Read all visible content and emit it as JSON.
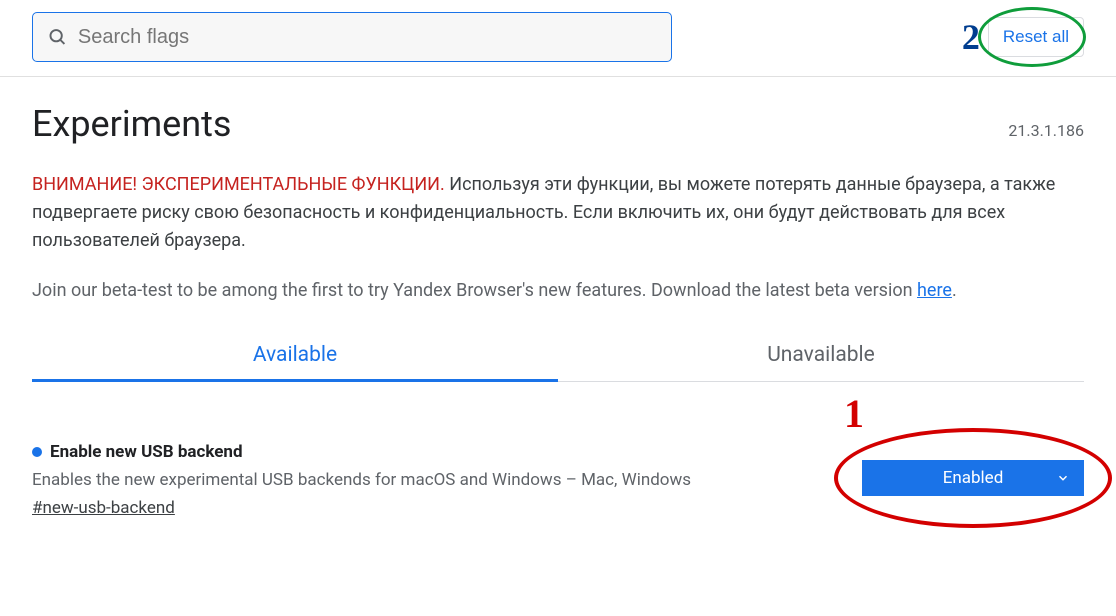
{
  "search": {
    "placeholder": "Search flags"
  },
  "annotations": {
    "one": "1",
    "two": "2"
  },
  "reset": {
    "label": "Reset all"
  },
  "header": {
    "title": "Experiments",
    "version": "21.3.1.186"
  },
  "warning": {
    "label": "ВНИМАНИЕ! ЭКСПЕРИМЕНТАЛЬНЫЕ ФУНКЦИИ.",
    "text": " Используя эти функции, вы можете потерять данные браузера, а также подвергаете риску свою безопасность и конфиденциальность. Если включить их, они будут действовать для всех пользователей браузера."
  },
  "beta": {
    "text": "Join our beta-test to be among the first to try Yandex Browser's new features. Download the latest beta version ",
    "link": "here",
    "suffix": "."
  },
  "tabs": {
    "available": "Available",
    "unavailable": "Unavailable"
  },
  "flag": {
    "title": "Enable new USB backend",
    "desc": "Enables the new experimental USB backends for macOS and Windows – Mac, Windows",
    "hash": "#new-usb-backend",
    "selected": "Enabled"
  }
}
